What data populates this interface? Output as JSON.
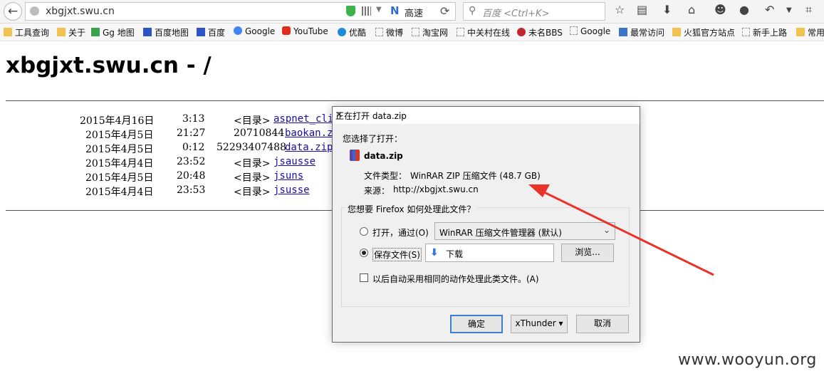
{
  "browser": {
    "url": "xbgjxt.swu.cn",
    "speed_label": "高速",
    "search_placeholder": "百度 <Ctrl+K>"
  },
  "bookmarks": [
    {
      "label": "工具查询",
      "icon": "folder-icon"
    },
    {
      "label": "关于",
      "icon": "folder-icon"
    },
    {
      "label": "Gg 地图",
      "icon": "map-icon"
    },
    {
      "label": "百度地图",
      "icon": "paw-icon"
    },
    {
      "label": "百度",
      "icon": "paw-icon"
    },
    {
      "label": "Google",
      "icon": "google-icon"
    },
    {
      "label": "YouTube",
      "icon": "youtube-icon"
    },
    {
      "label": "优酷",
      "icon": "play-icon"
    },
    {
      "label": "微博",
      "icon": "page-icon"
    },
    {
      "label": "淘宝网",
      "icon": "page-icon"
    },
    {
      "label": "中关村在线",
      "icon": "page-icon"
    },
    {
      "label": "未名BBS",
      "icon": "pku-icon"
    },
    {
      "label": "Google",
      "icon": "page-icon"
    },
    {
      "label": "最常访问",
      "icon": "smart-folder-icon"
    },
    {
      "label": "火狐官方站点",
      "icon": "folder-icon"
    },
    {
      "label": "新手上路",
      "icon": "page-icon"
    },
    {
      "label": "常用",
      "icon": "folder-icon"
    }
  ],
  "page": {
    "title": "xbgjxt.swu.cn - /",
    "listing": [
      {
        "date": "2015年4月16日",
        "time": "3:13",
        "size": "<目录>",
        "name": "aspnet_cli"
      },
      {
        "date": "2015年4月5日",
        "time": "21:27",
        "size": "20710844",
        "name": "baokan.z"
      },
      {
        "date": "2015年4月5日",
        "time": "0:12",
        "size": "52293407488",
        "name": "data.zip"
      },
      {
        "date": "2015年4月4日",
        "time": "23:52",
        "size": "<目录>",
        "name": "jsausse"
      },
      {
        "date": "2015年4月5日",
        "time": "20:48",
        "size": "<目录>",
        "name": "jsuns"
      },
      {
        "date": "2015年4月4日",
        "time": "23:53",
        "size": "<目录>",
        "name": "jsusse"
      }
    ]
  },
  "dialog": {
    "title": "正在打开 data.zip",
    "chosen_label": "您选择了打开：",
    "filename": "data.zip",
    "filetype_label": "文件类型：",
    "filetype_value": "WinRAR ZIP 压缩文件 (48.7 GB)",
    "source_label": "来源：",
    "source_value": "http://xbgjxt.swu.cn",
    "question": "您想要 Firefox 如何处理此文件？",
    "open_with_label": "打开，通过(O)",
    "open_with_app": "WinRAR 压缩文件管理器 (默认)",
    "save_label": "保存文件(S)",
    "save_location": "下载",
    "browse_label": "浏览...",
    "remember_label": "以后自动采用相同的动作处理此类文件。(A)",
    "ok_label": "确定",
    "xthunder_label": "xThunder ▾",
    "cancel_label": "取消",
    "selected_option": "save"
  },
  "watermark": "www.wooyun.org",
  "colors": {
    "annotation_arrow": "#e8322a",
    "link": "#1a0dab",
    "accent": "#3c7fd0"
  }
}
